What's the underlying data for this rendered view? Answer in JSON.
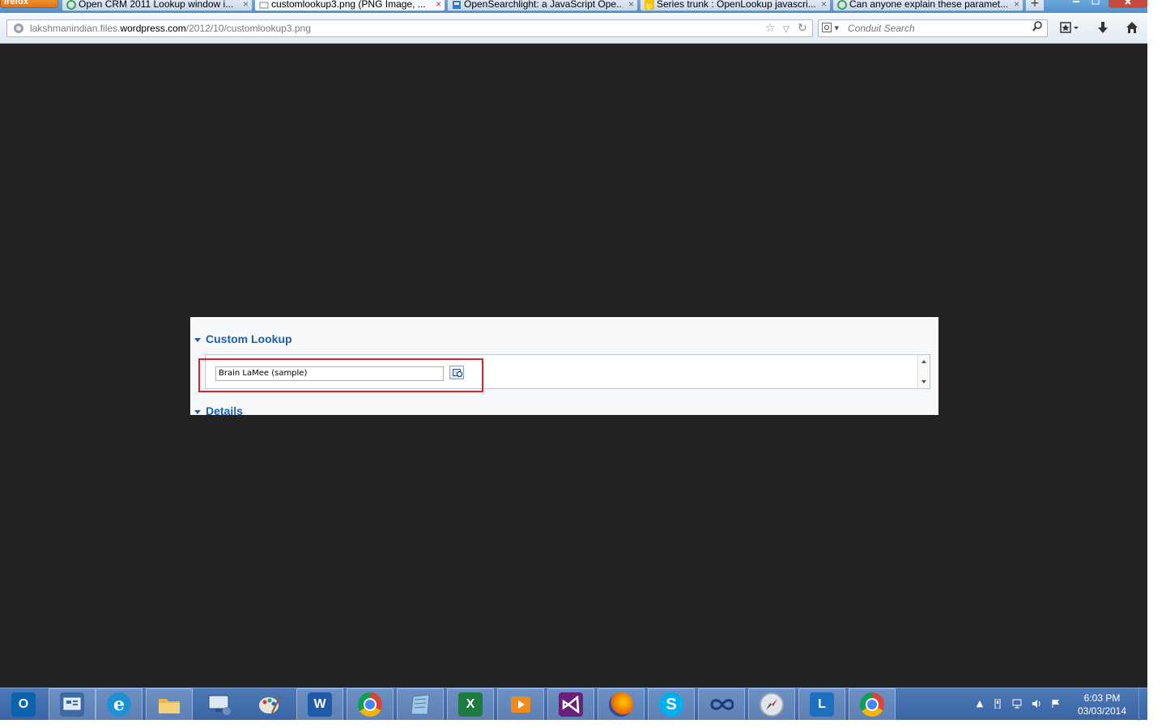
{
  "browser": {
    "menu_button_label": "irefox",
    "tabs": [
      {
        "title": "Open CRM 2011 Lookup window i...",
        "icon": "crm-icon",
        "active": false
      },
      {
        "title": "customlookup3.png (PNG Image, ...",
        "icon": "image-icon",
        "active": true
      },
      {
        "title": "OpenSearchlight: a JavaScript Ope...",
        "icon": "page-icon",
        "active": false
      },
      {
        "title": "Series trunk : OpenLookup javascri...",
        "icon": "launchpad-icon",
        "active": false
      },
      {
        "title": "Can anyone explain these paramet...",
        "icon": "crm-icon",
        "active": false
      }
    ],
    "new_tab_label": "+",
    "close_label": "×",
    "url": {
      "prefix": "lakshmanindian.files.",
      "domain": "wordpress.com",
      "path": "/2012/10/customlookup3.png"
    },
    "search": {
      "placeholder": "Conduit Search",
      "engine_icon": "conduit-icon"
    }
  },
  "screenshot": {
    "section_1_title": "Custom Lookup",
    "lookup_value": "Brain LaMee (sample)",
    "section_2_title": "Details",
    "highlight_color": "#d9232a",
    "link_color": "#1d5fa9"
  },
  "taskbar": {
    "apps": [
      {
        "name": "outlook",
        "label": "O",
        "color": "#0a64ad"
      },
      {
        "name": "server-manager",
        "label": "",
        "color": "#3b6aa5"
      },
      {
        "name": "internet-explorer",
        "label": "e",
        "color": "#1e90d6"
      },
      {
        "name": "file-explorer",
        "label": "",
        "color": "#e6b84a"
      },
      {
        "name": "remote-desktop",
        "label": "",
        "color": "#6f8fb8"
      },
      {
        "name": "paint",
        "label": "",
        "color": "#c8c8c8"
      },
      {
        "name": "word",
        "label": "W",
        "color": "#1e5aa8"
      },
      {
        "name": "chrome",
        "label": "",
        "color": "#db4437"
      },
      {
        "name": "notepad",
        "label": "",
        "color": "#9fc7e6"
      },
      {
        "name": "excel",
        "label": "X",
        "color": "#1f7a3f"
      },
      {
        "name": "media-player",
        "label": "",
        "color": "#f18a1d"
      },
      {
        "name": "visual-studio",
        "label": "",
        "color": "#68217a"
      },
      {
        "name": "firefox",
        "label": "",
        "color": "#e66000"
      },
      {
        "name": "skype",
        "label": "S",
        "color": "#00aff0"
      },
      {
        "name": "infinity-app",
        "label": "",
        "color": "#3a64a4"
      },
      {
        "name": "safari",
        "label": "",
        "color": "#bfc7cf"
      },
      {
        "name": "lync",
        "label": "L",
        "color": "#1f6fc1"
      },
      {
        "name": "chrome",
        "label": "",
        "color": "#db4437"
      }
    ],
    "clock_time": "6:03 PM",
    "clock_date": "03/03/2014"
  }
}
